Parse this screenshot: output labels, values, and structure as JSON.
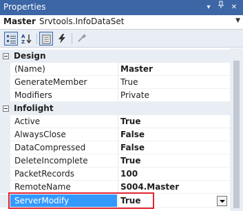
{
  "window": {
    "title": "Properties",
    "controls": {
      "dropdown": "▾",
      "pin": "📌",
      "close": "✕"
    }
  },
  "object_selector": {
    "name": "Master",
    "type": "Srvtools.InfoDataSet"
  },
  "toolbar": {
    "buttons": [
      "categorized-icon",
      "alphabetical-icon",
      "properties-icon",
      "events-icon",
      "property-pages-icon"
    ]
  },
  "grid": {
    "categories": [
      {
        "label": "Design",
        "properties": [
          {
            "name": "(Name)",
            "value": "Master",
            "bold": true
          },
          {
            "name": "GenerateMember",
            "value": "True",
            "bold": false
          },
          {
            "name": "Modifiers",
            "value": "Private",
            "bold": false
          }
        ]
      },
      {
        "label": "Infolight",
        "properties": [
          {
            "name": "Active",
            "value": "True",
            "bold": true
          },
          {
            "name": "AlwaysClose",
            "value": "False",
            "bold": true
          },
          {
            "name": "DataCompressed",
            "value": "False",
            "bold": true
          },
          {
            "name": "DeleteIncomplete",
            "value": "True",
            "bold": true
          },
          {
            "name": "PacketRecords",
            "value": "100",
            "bold": true
          },
          {
            "name": "RemoteName",
            "value": "S004.Master",
            "bold": true
          },
          {
            "name": "ServerModify",
            "value": "True",
            "bold": true,
            "selected": true
          }
        ]
      }
    ]
  },
  "colors": {
    "titlebar": "#3c66a6",
    "selection": "#3399ff",
    "highlight_border": "#e0242e"
  }
}
